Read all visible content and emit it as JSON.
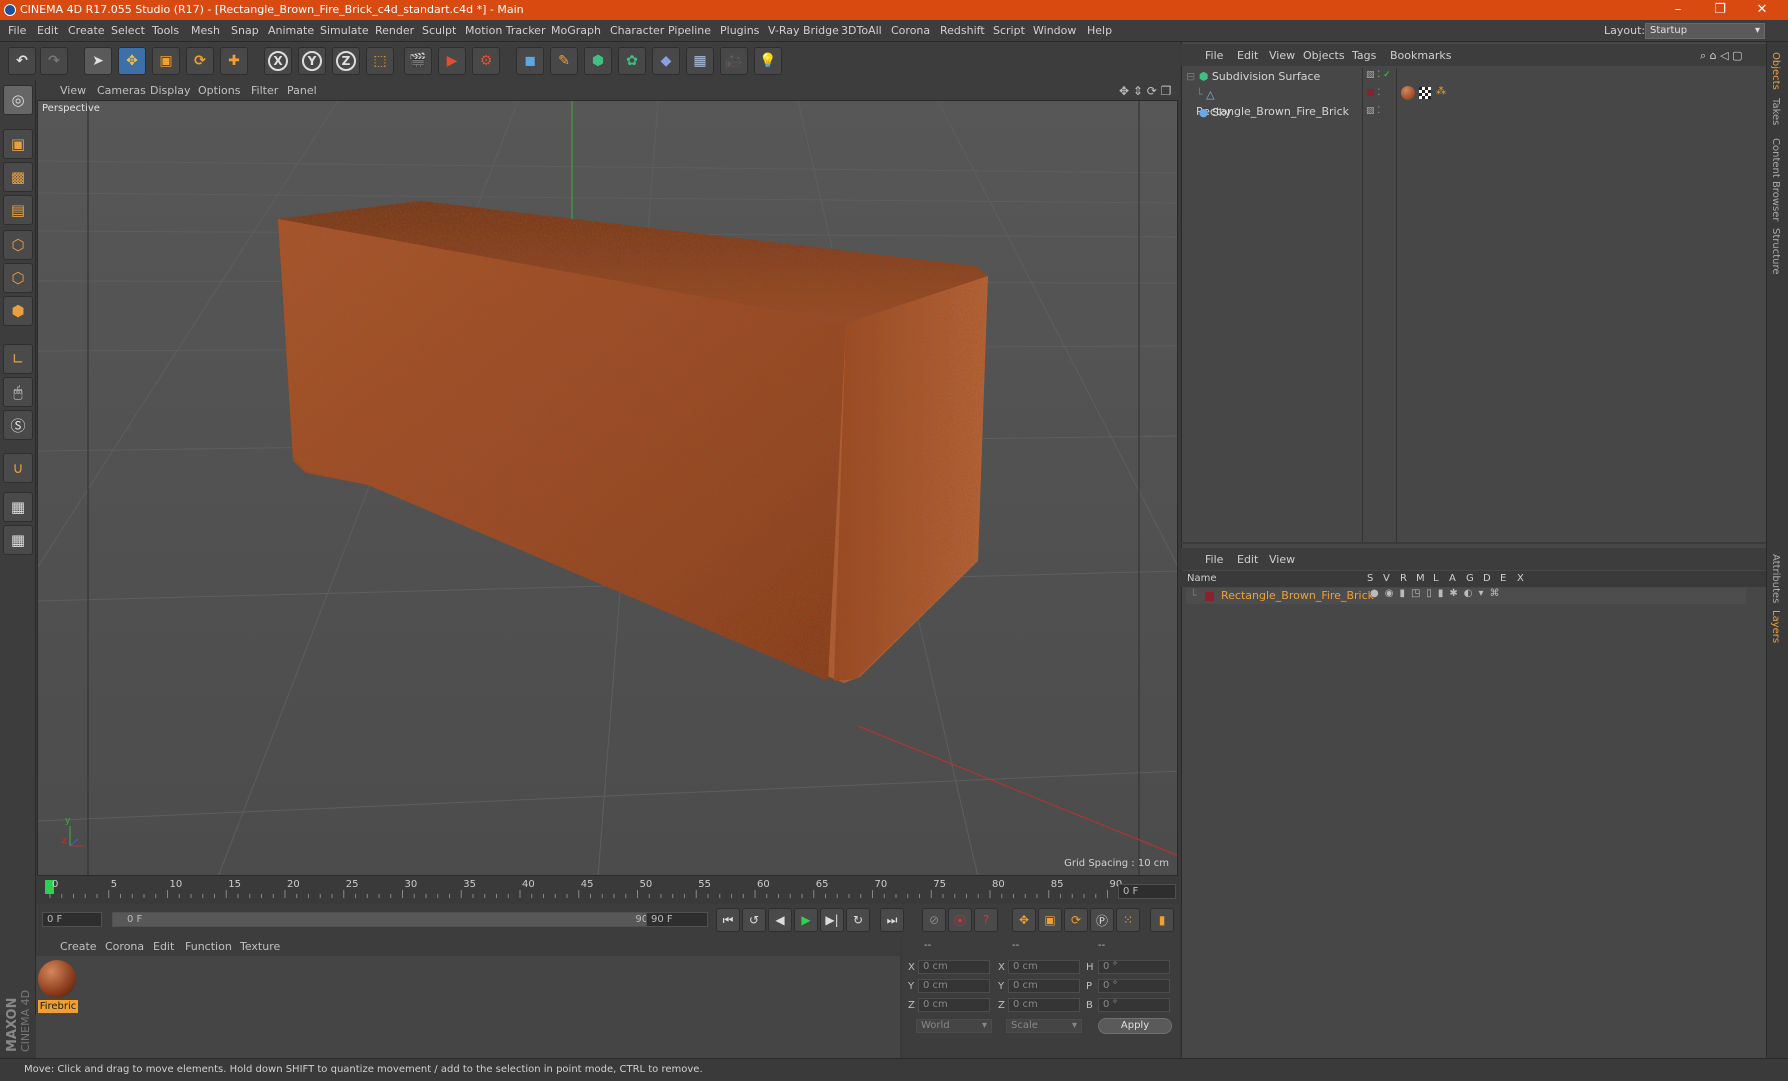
{
  "window": {
    "title": "CINEMA 4D R17.055 Studio (R17) - [Rectangle_Brown_Fire_Brick_c4d_standart.c4d *] - Main",
    "controls": [
      "–",
      "❐",
      "✕"
    ]
  },
  "menubar": {
    "items": [
      "File",
      "Edit",
      "Create",
      "Select",
      "Tools",
      "Mesh",
      "Snap",
      "Animate",
      "Simulate",
      "Render",
      "Sculpt",
      "Motion Tracker",
      "MoGraph",
      "Character",
      "Pipeline",
      "Plugins",
      "V-Ray Bridge",
      "3DToAll",
      "Corona",
      "Redshift",
      "Script",
      "Window",
      "Help"
    ],
    "layout_label": "Layout:",
    "layout_value": "Startup"
  },
  "viewport": {
    "menu": [
      "View",
      "Cameras",
      "Display",
      "Options",
      "Filter",
      "Panel"
    ],
    "label": "Perspective",
    "grid_spacing": "Grid Spacing : 10 cm"
  },
  "timeline": {
    "ticks": [
      "0",
      "5",
      "10",
      "15",
      "20",
      "25",
      "30",
      "35",
      "40",
      "45",
      "50",
      "55",
      "60",
      "65",
      "70",
      "75",
      "80",
      "85",
      "90"
    ],
    "current_frame": "0 F",
    "start_field": "0 F",
    "range_start": "0 F",
    "range_end": "90 F",
    "end_field": "90 F"
  },
  "material_manager": {
    "menu": [
      "Create",
      "Corona",
      "Edit",
      "Function",
      "Texture"
    ],
    "materials": [
      {
        "name": "Firebric"
      }
    ]
  },
  "coordinates": {
    "header": [
      "--",
      "--",
      "--"
    ],
    "rows": [
      {
        "a_label": "X",
        "a_val": "0 cm",
        "b_label": "X",
        "b_val": "0 cm",
        "c_label": "H",
        "c_val": "0 °"
      },
      {
        "a_label": "Y",
        "a_val": "0 cm",
        "b_label": "Y",
        "b_val": "0 cm",
        "c_label": "P",
        "c_val": "0 °"
      },
      {
        "a_label": "Z",
        "a_val": "0 cm",
        "b_label": "Z",
        "b_val": "0 cm",
        "c_label": "B",
        "c_val": "0 °"
      }
    ],
    "world": "World",
    "scale": "Scale",
    "apply": "Apply"
  },
  "object_manager": {
    "menu": [
      "File",
      "Edit",
      "View",
      "Objects",
      "Tags",
      "Bookmarks"
    ],
    "objects": [
      "Subdivision Surface",
      "Rectangle_Brown_Fire_Brick",
      "Sky"
    ]
  },
  "layer_manager": {
    "menu": [
      "File",
      "Edit",
      "View"
    ],
    "columns": [
      "Name",
      "S",
      "V",
      "R",
      "M",
      "L",
      "A",
      "G",
      "D",
      "E",
      "X"
    ],
    "layers": [
      "Rectangle_Brown_Fire_Brick"
    ]
  },
  "right_tabs": [
    "Objects",
    "Takes",
    "Content Browser",
    "Structure",
    "Attributes",
    "Layers"
  ],
  "status": "Move: Click and drag to move elements. Hold down SHIFT to quantize movement / add to the selection in point mode, CTRL to remove.",
  "logo": "MAXON CINEMA 4D",
  "colors": {
    "titlebar": "#d84a10",
    "brick": "#9a4a24",
    "highlight": "#f0a030"
  }
}
